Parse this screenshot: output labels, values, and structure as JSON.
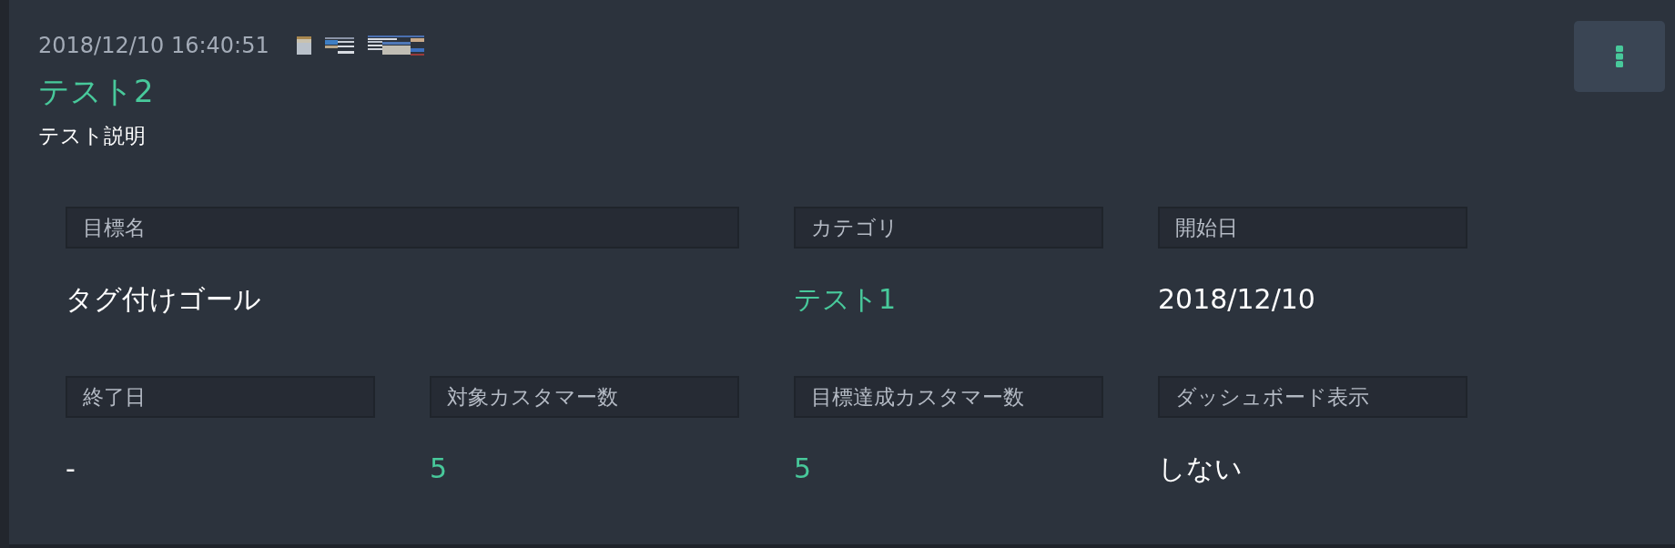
{
  "card": {
    "timestamp": "2018/12/10 16:40:51",
    "title": "テスト2",
    "description": "テスト説明"
  },
  "details": {
    "rows": [
      {
        "fields": [
          {
            "label": "目標名",
            "value": "タグ付けゴール",
            "kind": "text"
          },
          {
            "label": "カテゴリ",
            "value": "テスト1",
            "kind": "link"
          },
          {
            "label": "開始日",
            "value": "2018/12/10",
            "kind": "text"
          }
        ]
      },
      {
        "fields": [
          {
            "label": "終了日",
            "value": "-",
            "kind": "text"
          },
          {
            "label": "対象カスタマー数",
            "value": "5",
            "kind": "link"
          },
          {
            "label": "目標達成カスタマー数",
            "value": "5",
            "kind": "link"
          },
          {
            "label": "ダッシュボード表示",
            "value": "しない",
            "kind": "text"
          }
        ]
      }
    ]
  }
}
